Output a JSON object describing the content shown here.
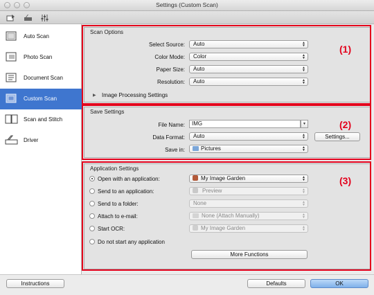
{
  "window": {
    "title": "Settings (Custom Scan)"
  },
  "toolbar": {
    "icons": [
      "scan-settings-icon",
      "scanner-icon",
      "general-settings-icon"
    ]
  },
  "sidebar": {
    "items": [
      {
        "label": "Auto Scan",
        "icon": "auto-scan-icon",
        "selected": false
      },
      {
        "label": "Photo Scan",
        "icon": "photo-scan-icon",
        "selected": false
      },
      {
        "label": "Document Scan",
        "icon": "document-scan-icon",
        "selected": false
      },
      {
        "label": "Custom Scan",
        "icon": "custom-scan-icon",
        "selected": true
      },
      {
        "label": "Scan and Stitch",
        "icon": "scan-stitch-icon",
        "selected": false
      },
      {
        "label": "Driver",
        "icon": "driver-icon",
        "selected": false
      }
    ]
  },
  "scan_options": {
    "title": "Scan Options",
    "marker": "(1)",
    "select_source": {
      "label": "Select Source:",
      "value": "Auto"
    },
    "color_mode": {
      "label": "Color Mode:",
      "value": "Color"
    },
    "paper_size": {
      "label": "Paper Size:",
      "value": "Auto"
    },
    "resolution": {
      "label": "Resolution:",
      "value": "Auto"
    },
    "image_processing": "Image Processing Settings"
  },
  "save_settings": {
    "title": "Save Settings",
    "marker": "(2)",
    "file_name": {
      "label": "File Name:",
      "value": "IMG"
    },
    "data_format": {
      "label": "Data Format:",
      "value": "Auto"
    },
    "settings_button": "Settings...",
    "save_in": {
      "label": "Save in:",
      "value": "Pictures"
    }
  },
  "application_settings": {
    "title": "Application Settings",
    "marker": "(3)",
    "options": [
      {
        "label": "Open with an application:",
        "value": "My Image Garden",
        "selected": true,
        "enabled": true
      },
      {
        "label": "Send to an application:",
        "value": "Preview",
        "selected": false,
        "enabled": false
      },
      {
        "label": "Send to a folder:",
        "value": "None",
        "selected": false,
        "enabled": false
      },
      {
        "label": "Attach to e-mail:",
        "value": "None (Attach Manually)",
        "selected": false,
        "enabled": false
      },
      {
        "label": "Start OCR:",
        "value": "My Image Garden",
        "selected": false,
        "enabled": false
      },
      {
        "label": "Do not start any application",
        "value": null,
        "selected": false,
        "enabled": false
      }
    ],
    "more_functions": "More Functions"
  },
  "footer": {
    "instructions": "Instructions",
    "defaults": "Defaults",
    "ok": "OK"
  },
  "colors": {
    "selection": "#3f76cf",
    "marker_red": "#e3001b",
    "ok_button": "#7fb0ea"
  }
}
